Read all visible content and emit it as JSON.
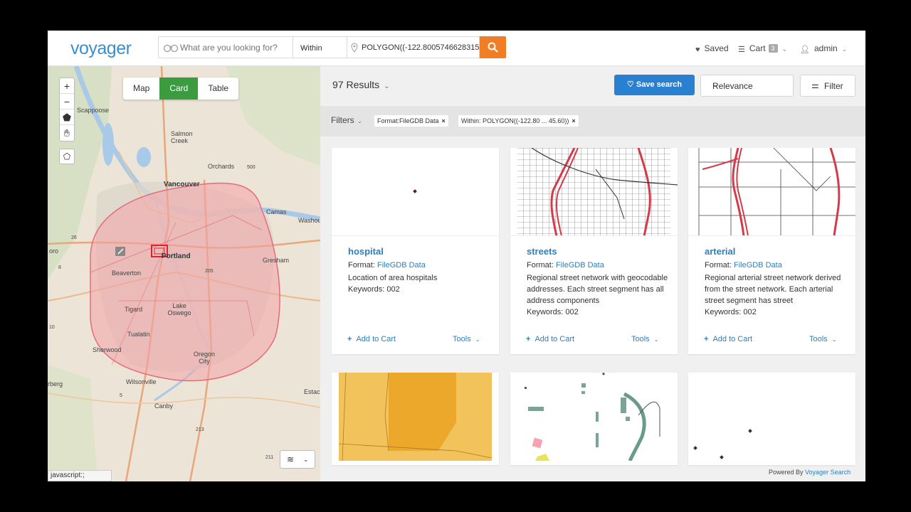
{
  "header": {
    "logo": "voyager",
    "search_placeholder": "What are you looking for?",
    "within_label": "Within",
    "polygon_value": "POLYGON((-122.8005746628315:",
    "nav": {
      "saved": "Saved",
      "cart": "Cart",
      "cart_count": "3",
      "user": "admin"
    }
  },
  "map": {
    "view_tabs": [
      "Map",
      "Card",
      "Table"
    ],
    "active_view": "Card",
    "zoom_in": "+",
    "zoom_out": "−",
    "status_link": "javascript:;",
    "labels": {
      "scappoose": "Scappoose",
      "salmon_creek": "Salmon Creek",
      "orchards": "Orchards",
      "vancouver": "Vancouver",
      "camas": "Camas",
      "washougal": "Washou",
      "portland": "Portland",
      "gresham": "Gresham",
      "beaverton": "Beaverton",
      "tigard": "Tigard",
      "lake_oswego": "Lake Oswego",
      "tualatin": "Tualatin",
      "sherwood": "Sherwood",
      "oregon_city": "Oregon City",
      "wilsonville": "Wilsonville",
      "canby": "Canby",
      "hillsboro_edge": "oro",
      "newberg_edge": "rberg",
      "estacada_edge": "Estac",
      "r500": "500",
      "r26": "26",
      "r8": "8",
      "r10": "10",
      "r205": "205",
      "r5": "5",
      "r213": "213",
      "r211": "211"
    }
  },
  "results": {
    "count_label": "97 Results",
    "save_search": "Save search",
    "sort": "Relevance",
    "filter": "Filter",
    "filters_label": "Filters",
    "chips": [
      "Format:FileGDB Data",
      "Within: POLYGON((-122.80 ... 45.60))"
    ],
    "cards": [
      {
        "title": "hospital",
        "format_label": "Format:",
        "format": "FileGDB Data",
        "description": "Location of area hospitals",
        "keywords": "Keywords: 002",
        "add": "Add to Cart",
        "tools": "Tools"
      },
      {
        "title": "streets",
        "format_label": "Format:",
        "format": "FileGDB Data",
        "description": "Regional street network with geocodable addresses. Each street segment has all address components",
        "keywords": "Keywords: 002",
        "add": "Add to Cart",
        "tools": "Tools"
      },
      {
        "title": "arterial",
        "format_label": "Format:",
        "format": "FileGDB Data",
        "description": "Regional arterial street network derived from the street network. Each arterial street segment has street",
        "keywords": "Keywords: 002",
        "add": "Add to Cart",
        "tools": "Tools"
      }
    ],
    "powered_by": "Powered By",
    "powered_link": "Voyager Search"
  },
  "colors": {
    "brand": "#3a8fd1",
    "search_button": "#f07e26",
    "active_tab": "#3a9b3f",
    "save_button": "#2a80d0",
    "link": "#2a7fbf"
  }
}
